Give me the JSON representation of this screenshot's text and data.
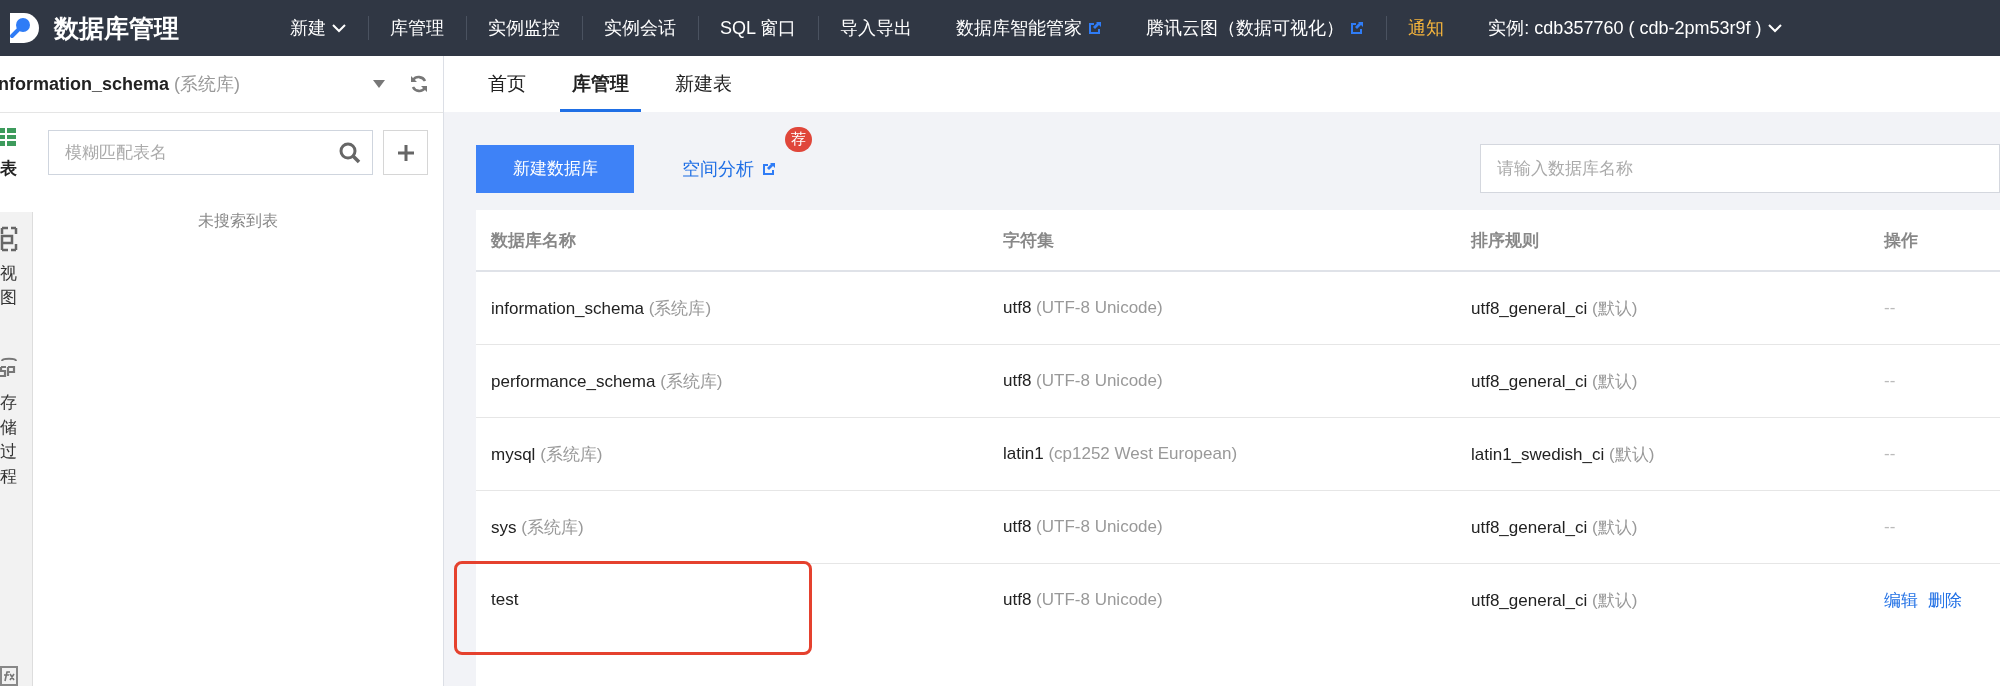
{
  "app": {
    "title": "数据库管理"
  },
  "nav": [
    {
      "label": "新建",
      "kind": "menu",
      "divider_before": false
    },
    {
      "label": "库管理",
      "kind": "plain",
      "divider_before": true
    },
    {
      "label": "实例监控",
      "kind": "plain",
      "divider_before": true
    },
    {
      "label": "实例会话",
      "kind": "plain",
      "divider_before": true
    },
    {
      "label": "SQL 窗口",
      "kind": "plain",
      "divider_before": true
    },
    {
      "label": "导入导出",
      "kind": "plain",
      "divider_before": true
    },
    {
      "label": "数据库智能管家",
      "kind": "external",
      "divider_before": false
    },
    {
      "label": "腾讯云图（数据可视化）",
      "kind": "external",
      "divider_before": false
    },
    {
      "label": "通知",
      "kind": "notice",
      "divider_before": true
    },
    {
      "label": "实例: cdb357760 ( cdb-2pm53r9f )",
      "kind": "menu",
      "divider_before": false
    }
  ],
  "sidebar": {
    "database": {
      "name": "nformation_schema",
      "note": "(系统库)"
    },
    "object_tabs": [
      {
        "kind": "table",
        "label": "表",
        "selected": true
      },
      {
        "kind": "view",
        "label": "视图",
        "selected": false
      },
      {
        "kind": "procedure",
        "label": "存储过程",
        "selected": false
      },
      {
        "kind": "function",
        "selected": false
      }
    ],
    "search": {
      "placeholder": "模糊匹配表名"
    },
    "empty_text": "未搜索到表"
  },
  "tabs": [
    {
      "label": "首页",
      "selected": false
    },
    {
      "label": "库管理",
      "selected": true
    },
    {
      "label": "新建表",
      "selected": false
    }
  ],
  "toolbar": {
    "create_button": "新建数据库",
    "analysis_link": "空间分析",
    "badge": "荐",
    "search": {
      "placeholder": "请输入数据库名称"
    }
  },
  "table": {
    "columns": [
      "数据库名称",
      "字符集",
      "排序规则",
      "操作"
    ],
    "rows": [
      {
        "name": "information_schema",
        "name_note": "(系统库)",
        "charset": "utf8",
        "charset_note": "(UTF-8 Unicode)",
        "collation": "utf8_general_ci",
        "collation_note": "(默认)",
        "highlighted": false,
        "actions": [
          {
            "kind": "none",
            "label": "--"
          }
        ]
      },
      {
        "name": "performance_schema",
        "name_note": "(系统库)",
        "charset": "utf8",
        "charset_note": "(UTF-8 Unicode)",
        "collation": "utf8_general_ci",
        "collation_note": "(默认)",
        "highlighted": false,
        "actions": [
          {
            "kind": "none",
            "label": "--"
          }
        ]
      },
      {
        "name": "mysql",
        "name_note": "(系统库)",
        "charset": "latin1",
        "charset_note": "(cp1252 West European)",
        "collation": "latin1_swedish_ci",
        "collation_note": "(默认)",
        "highlighted": false,
        "actions": [
          {
            "kind": "none",
            "label": "--"
          }
        ]
      },
      {
        "name": "sys",
        "name_note": "(系统库)",
        "charset": "utf8",
        "charset_note": "(UTF-8 Unicode)",
        "collation": "utf8_general_ci",
        "collation_note": "(默认)",
        "highlighted": false,
        "actions": [
          {
            "kind": "none",
            "label": "--"
          }
        ]
      },
      {
        "name": "test",
        "charset": "utf8",
        "charset_note": "(UTF-8 Unicode)",
        "collation": "utf8_general_ci",
        "collation_note": "(默认)",
        "highlighted": true,
        "actions": [
          {
            "kind": "link",
            "label": "编辑"
          },
          {
            "kind": "link",
            "label": "删除"
          }
        ]
      }
    ]
  }
}
